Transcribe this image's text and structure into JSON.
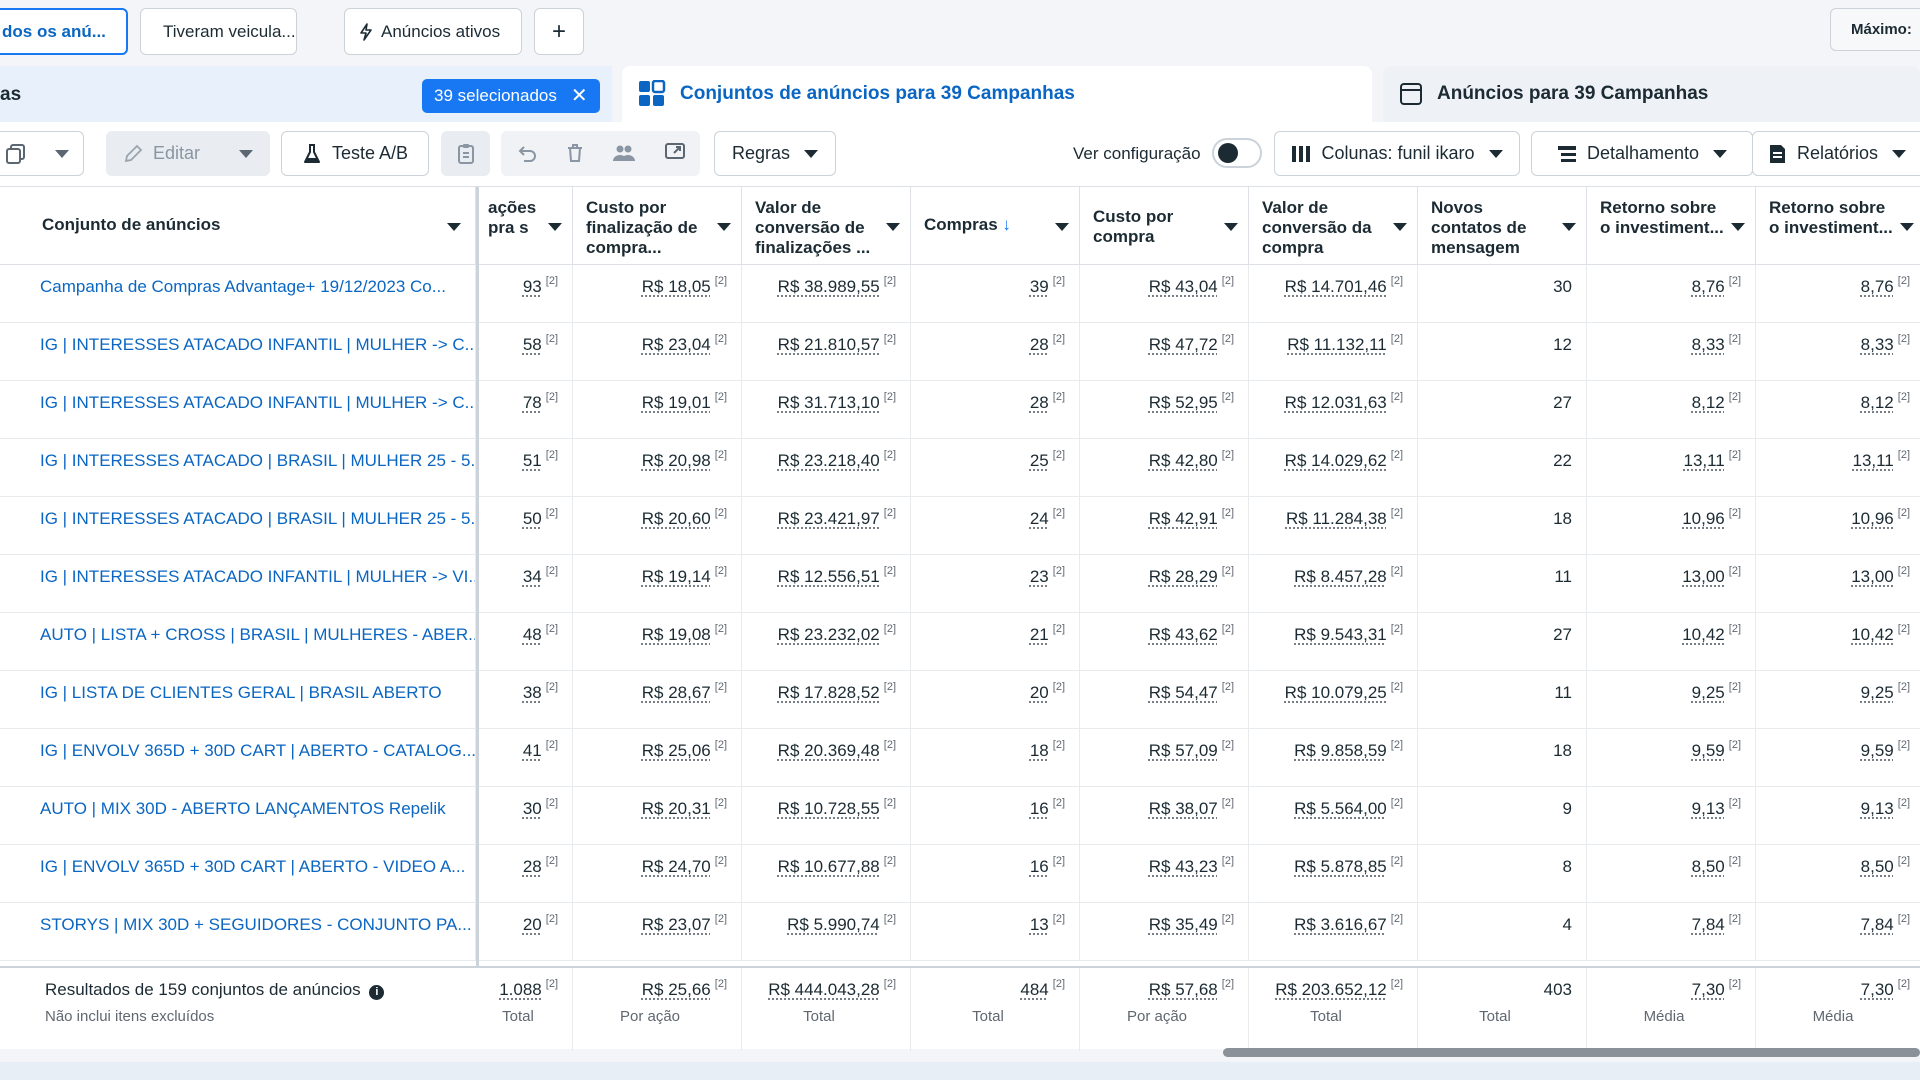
{
  "filters": {
    "chips": [
      "dos os anú...",
      "Tiveram veicula...",
      "Anúncios ativos"
    ],
    "add_label": "+",
    "max_label": "Máximo:"
  },
  "tabs": {
    "campaigns_label": "as",
    "selected_label": "39 selecionados",
    "adsets_label": "Conjuntos de anúncios para 39 Campanhas",
    "ads_label": "Anúncios para 39 Campanhas"
  },
  "toolbar": {
    "edit_label": "Editar",
    "ab_label": "Teste A/B",
    "rules_label": "Regras",
    "view_config_label": "Ver configuração",
    "columns_label": "Colunas: funil ikaro",
    "breakdown_label": "Detalhamento",
    "reports_label": "Relatórios"
  },
  "table": {
    "headers": {
      "name": "Conjunto de anúncios",
      "c1": "ações pra s",
      "c2": "Custo por finalização de compra...",
      "c3": "Valor de conversão de finalizações ...",
      "c4": "Compras",
      "c5": "Custo por compra",
      "c6": "Valor de conversão da compra",
      "c7": "Novos contatos de mensagem",
      "c8": "Retorno sobre o investiment...",
      "c9": "Retorno sobre o investiment..."
    },
    "sup": "[2]",
    "rows": [
      {
        "name": "Campanha de Compras Advantage+ 19/12/2023 Co...",
        "c1": "93",
        "c2": "R$ 18,05",
        "c3": "R$ 38.989,55",
        "c4": "39",
        "c5": "R$ 43,04",
        "c6": "R$ 14.701,46",
        "c7": "30",
        "c8": "8,76",
        "c9": "8,76"
      },
      {
        "name": "IG | INTERESSES ATACADO INFANTIL | MULHER -> C...",
        "c1": "58",
        "c2": "R$ 23,04",
        "c3": "R$ 21.810,57",
        "c4": "28",
        "c5": "R$ 47,72",
        "c6": "R$ 11.132,11",
        "c7": "12",
        "c8": "8,33",
        "c9": "8,33"
      },
      {
        "name": "IG | INTERESSES ATACADO INFANTIL | MULHER -> C...",
        "c1": "78",
        "c2": "R$ 19,01",
        "c3": "R$ 31.713,10",
        "c4": "28",
        "c5": "R$ 52,95",
        "c6": "R$ 12.031,63",
        "c7": "27",
        "c8": "8,12",
        "c9": "8,12"
      },
      {
        "name": "IG | INTERESSES ATACADO | BRASIL | MULHER 25 - 5...",
        "c1": "51",
        "c2": "R$ 20,98",
        "c3": "R$ 23.218,40",
        "c4": "25",
        "c5": "R$ 42,80",
        "c6": "R$ 14.029,62",
        "c7": "22",
        "c8": "13,11",
        "c9": "13,11"
      },
      {
        "name": "IG | INTERESSES ATACADO | BRASIL | MULHER 25 - 5...",
        "c1": "50",
        "c2": "R$ 20,60",
        "c3": "R$ 23.421,97",
        "c4": "24",
        "c5": "R$ 42,91",
        "c6": "R$ 11.284,38",
        "c7": "18",
        "c8": "10,96",
        "c9": "10,96"
      },
      {
        "name": "IG | INTERESSES ATACADO INFANTIL | MULHER -> VI...",
        "c1": "34",
        "c2": "R$ 19,14",
        "c3": "R$ 12.556,51",
        "c4": "23",
        "c5": "R$ 28,29",
        "c6": "R$ 8.457,28",
        "c7": "11",
        "c8": "13,00",
        "c9": "13,00"
      },
      {
        "name": "AUTO | LISTA + CROSS | BRASIL | MULHERES - ABER...",
        "c1": "48",
        "c2": "R$ 19,08",
        "c3": "R$ 23.232,02",
        "c4": "21",
        "c5": "R$ 43,62",
        "c6": "R$ 9.543,31",
        "c7": "27",
        "c8": "10,42",
        "c9": "10,42"
      },
      {
        "name": "IG | LISTA DE CLIENTES GERAL | BRASIL ABERTO",
        "c1": "38",
        "c2": "R$ 28,67",
        "c3": "R$ 17.828,52",
        "c4": "20",
        "c5": "R$ 54,47",
        "c6": "R$ 10.079,25",
        "c7": "11",
        "c8": "9,25",
        "c9": "9,25"
      },
      {
        "name": "IG | ENVOLV 365D + 30D CART | ABERTO - CATALOG...",
        "c1": "41",
        "c2": "R$ 25,06",
        "c3": "R$ 20.369,48",
        "c4": "18",
        "c5": "R$ 57,09",
        "c6": "R$ 9.858,59",
        "c7": "18",
        "c8": "9,59",
        "c9": "9,59"
      },
      {
        "name": "AUTO | MIX 30D - ABERTO LANÇAMENTOS Repelik",
        "c1": "30",
        "c2": "R$ 20,31",
        "c3": "R$ 10.728,55",
        "c4": "16",
        "c5": "R$ 38,07",
        "c6": "R$ 5.564,00",
        "c7": "9",
        "c8": "9,13",
        "c9": "9,13"
      },
      {
        "name": "IG | ENVOLV 365D + 30D CART | ABERTO - VIDEO A...",
        "c1": "28",
        "c2": "R$ 24,70",
        "c3": "R$ 10.677,88",
        "c4": "16",
        "c5": "R$ 43,23",
        "c6": "R$ 5.878,85",
        "c7": "8",
        "c8": "8,50",
        "c9": "8,50"
      },
      {
        "name": "STORYS | MIX 30D + SEGUIDORES - CONJUNTO PA...",
        "c1": "20",
        "c2": "R$ 23,07",
        "c3": "R$ 5.990,74",
        "c4": "13",
        "c5": "R$ 35,49",
        "c6": "R$ 3.616,67",
        "c7": "4",
        "c8": "7,84",
        "c9": "7,84"
      }
    ],
    "footer": {
      "title": "Resultados de 159 conjuntos de anúncios",
      "subtitle": "Não inclui itens excluídos",
      "c1": "1.088",
      "c1s": "Total",
      "c2": "R$ 25,66",
      "c2s": "Por ação",
      "c3": "R$ 444.043,28",
      "c3s": "Total",
      "c4": "484",
      "c4s": "Total",
      "c5": "R$ 57,68",
      "c5s": "Por ação",
      "c6": "R$ 203.652,12",
      "c6s": "Total",
      "c7": "403",
      "c7s": "Total",
      "c8": "7,30",
      "c8s": "Média",
      "c9": "7,30",
      "c9s": "Média"
    }
  },
  "colors": {
    "accent": "#1877f2",
    "link": "#0a66c2"
  }
}
